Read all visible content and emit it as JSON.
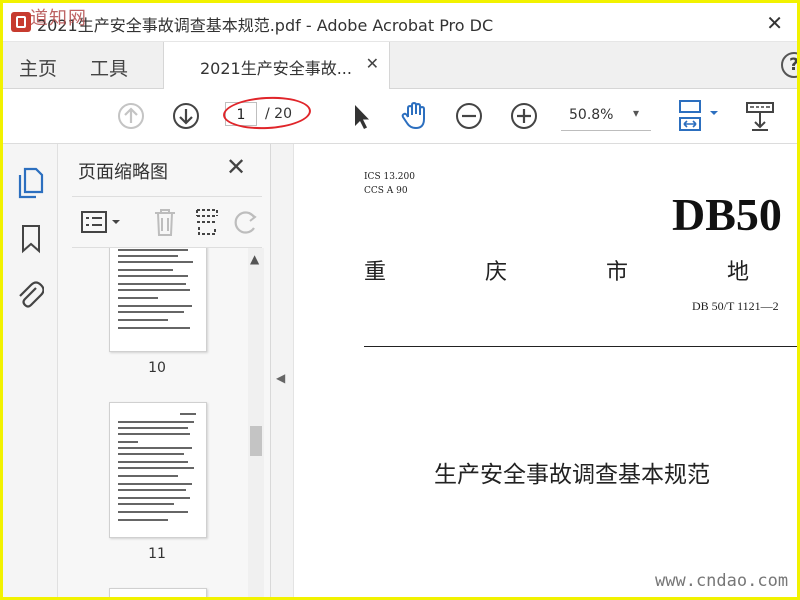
{
  "window": {
    "title": "2021生产安全事故调查基本规范.pdf - Adobe Acrobat Pro DC",
    "close_glyph": "✕"
  },
  "tabs": {
    "home": "主页",
    "tools": "工具",
    "document_tab": "2021生产安全事故...",
    "document_tab_close": "✕",
    "help": "?"
  },
  "toolbar": {
    "page_current": "1",
    "page_total": "/ 20",
    "zoom": "50.8%",
    "zoom_caret": "▾",
    "icons": [
      "arrow-up-icon",
      "arrow-down-icon",
      "select-cursor-icon",
      "hand-icon",
      "zoom-out-icon",
      "zoom-in-icon",
      "fit-page-icon",
      "scroll-mode-icon"
    ]
  },
  "rail": {
    "icons": [
      "page-thumbnails-icon",
      "bookmark-icon",
      "attachment-icon"
    ]
  },
  "thumbnail_panel": {
    "title": "页面缩略图",
    "close": "✕",
    "pages": [
      {
        "label": "10"
      },
      {
        "label": "11"
      }
    ]
  },
  "document": {
    "ics": "ICS 13.200",
    "ccs": "CCS A 90",
    "standard_code": "DB50",
    "heading": "重 庆 市 地 方 标",
    "number": "DB 50/T 1121—2",
    "title": "生产安全事故调查基本规范"
  },
  "watermark": {
    "footer": "www.cndao.com",
    "stamp": "道知网"
  },
  "colors": {
    "border": "#f2f200",
    "annotation": "#e0252a",
    "accent": "#2c6fbf"
  }
}
